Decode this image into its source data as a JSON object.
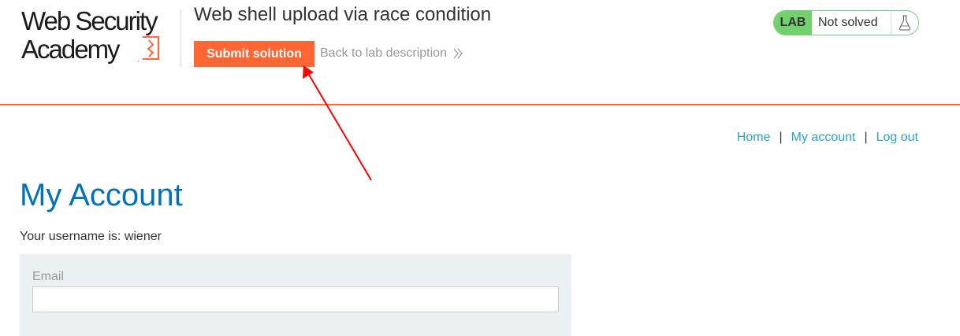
{
  "header": {
    "logo_line1": "Web Security",
    "logo_line2": "Academy",
    "lab_title": "Web shell upload via race condition",
    "submit_label": "Submit solution",
    "back_label": "Back to lab description",
    "status_tag": "LAB",
    "status_text": "Not solved",
    "status_icon": "flask-icon",
    "accent_color": "#ff6633",
    "status_color": "#70d16d"
  },
  "nav": {
    "home": "Home",
    "separator": "|",
    "account": "My account",
    "logout": "Log out"
  },
  "main": {
    "title": "My Account",
    "username_text": "Your username is: wiener",
    "email_label": "Email",
    "email_value": ""
  },
  "annotation": {
    "arrow_color": "#ff0000",
    "points_to": "submit-solution-button"
  }
}
